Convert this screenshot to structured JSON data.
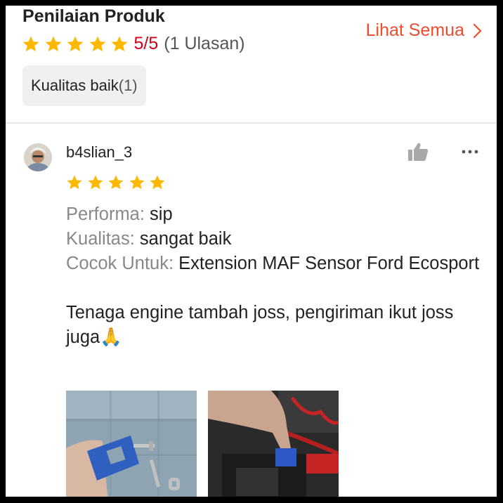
{
  "header": {
    "title": "Penilaian Produk",
    "rating_value": "5/5",
    "rating_count": "(1 Ulasan)",
    "see_all_label": "Lihat Semua",
    "star_count": 5
  },
  "tags": [
    {
      "label": "Kualitas baik",
      "count": "(1)"
    }
  ],
  "review": {
    "username": "b4slian_3",
    "stars": 5,
    "attributes": [
      {
        "label": "Performa:",
        "value": "sip"
      },
      {
        "label": "Kualitas:",
        "value": "sangat baik"
      },
      {
        "label": "Cocok Untuk:",
        "value": "Extension MAF Sensor Ford Ecosport"
      }
    ],
    "comment": "Tenaga engine tambah joss, pengiriman ikut joss juga",
    "comment_emoji": "🙏"
  },
  "colors": {
    "star": "#ffb800",
    "accent": "#ee4d2d",
    "rating_red": "#d0011b"
  },
  "icons": {
    "see_all": "chevron-right-icon",
    "like": "thumbs-up-icon",
    "more": "more-dots-icon"
  }
}
